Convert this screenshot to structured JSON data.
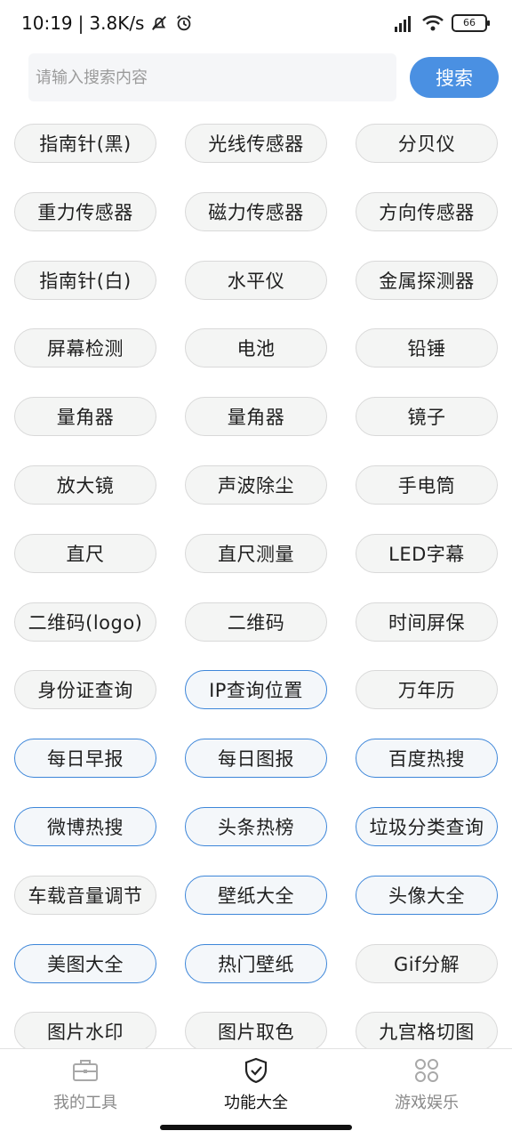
{
  "status": {
    "time": "10:19",
    "speed": "3.8K/s",
    "battery": "66"
  },
  "search": {
    "placeholder": "请输入搜索内容",
    "button_label": "搜索"
  },
  "tools": [
    {
      "label": "指南针(黑)",
      "highlighted": false
    },
    {
      "label": "光线传感器",
      "highlighted": false
    },
    {
      "label": "分贝仪",
      "highlighted": false
    },
    {
      "label": "重力传感器",
      "highlighted": false
    },
    {
      "label": "磁力传感器",
      "highlighted": false
    },
    {
      "label": "方向传感器",
      "highlighted": false
    },
    {
      "label": "指南针(白)",
      "highlighted": false
    },
    {
      "label": "水平仪",
      "highlighted": false
    },
    {
      "label": "金属探测器",
      "highlighted": false
    },
    {
      "label": "屏幕检测",
      "highlighted": false
    },
    {
      "label": "电池",
      "highlighted": false
    },
    {
      "label": "铅锤",
      "highlighted": false
    },
    {
      "label": "量角器",
      "highlighted": false
    },
    {
      "label": "量角器",
      "highlighted": false
    },
    {
      "label": "镜子",
      "highlighted": false
    },
    {
      "label": "放大镜",
      "highlighted": false
    },
    {
      "label": "声波除尘",
      "highlighted": false
    },
    {
      "label": "手电筒",
      "highlighted": false
    },
    {
      "label": "直尺",
      "highlighted": false
    },
    {
      "label": "直尺测量",
      "highlighted": false
    },
    {
      "label": "LED字幕",
      "highlighted": false
    },
    {
      "label": "二维码(logo)",
      "highlighted": false
    },
    {
      "label": "二维码",
      "highlighted": false
    },
    {
      "label": "时间屏保",
      "highlighted": false
    },
    {
      "label": "身份证查询",
      "highlighted": false
    },
    {
      "label": "IP查询位置",
      "highlighted": true
    },
    {
      "label": "万年历",
      "highlighted": false
    },
    {
      "label": "每日早报",
      "highlighted": true
    },
    {
      "label": "每日图报",
      "highlighted": true
    },
    {
      "label": "百度热搜",
      "highlighted": true
    },
    {
      "label": "微博热搜",
      "highlighted": true
    },
    {
      "label": "头条热榜",
      "highlighted": true
    },
    {
      "label": "垃圾分类查询",
      "highlighted": true
    },
    {
      "label": "车载音量调节",
      "highlighted": false
    },
    {
      "label": "壁纸大全",
      "highlighted": true
    },
    {
      "label": "头像大全",
      "highlighted": true
    },
    {
      "label": "美图大全",
      "highlighted": true
    },
    {
      "label": "热门壁纸",
      "highlighted": true
    },
    {
      "label": "Gif分解",
      "highlighted": false
    },
    {
      "label": "图片水印",
      "highlighted": false
    },
    {
      "label": "图片取色",
      "highlighted": false
    },
    {
      "label": "九宫格切图",
      "highlighted": false
    }
  ],
  "nav": {
    "items": [
      {
        "label": "我的工具",
        "icon": "toolbox-icon",
        "active": false
      },
      {
        "label": "功能大全",
        "icon": "shield-check-icon",
        "active": true
      },
      {
        "label": "游戏娱乐",
        "icon": "grid-icon",
        "active": false
      }
    ]
  },
  "colors": {
    "accent": "#4a90e2",
    "highlight_border": "#3d86d9"
  }
}
